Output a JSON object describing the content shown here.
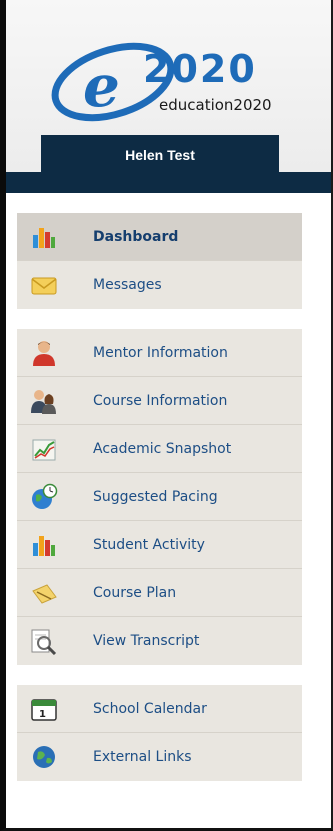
{
  "brand": {
    "logo_text": "2020",
    "logo_subtext": "education2020"
  },
  "user": {
    "name": "Helen Test"
  },
  "nav": {
    "groups": [
      {
        "items": [
          {
            "label": "Dashboard",
            "icon": "bar-chart-icon"
          },
          {
            "label": "Messages",
            "icon": "envelope-icon"
          }
        ]
      },
      {
        "items": [
          {
            "label": "Mentor Information",
            "icon": "person-icon"
          },
          {
            "label": "Course Information",
            "icon": "people-icon"
          },
          {
            "label": "Academic Snapshot",
            "icon": "trend-chart-icon"
          },
          {
            "label": "Suggested Pacing",
            "icon": "globe-clock-icon"
          },
          {
            "label": "Student Activity",
            "icon": "bar-chart-icon"
          },
          {
            "label": "Course Plan",
            "icon": "document-pencil-icon"
          },
          {
            "label": "View Transcript",
            "icon": "magnifier-document-icon"
          }
        ]
      },
      {
        "items": [
          {
            "label": "School Calendar",
            "icon": "calendar-icon"
          },
          {
            "label": "External Links",
            "icon": "globe-icon"
          }
        ]
      }
    ]
  },
  "colors": {
    "header_navy": "#0d2b44",
    "link_blue": "#1d4e85",
    "logo_blue": "#1e6bb8"
  }
}
